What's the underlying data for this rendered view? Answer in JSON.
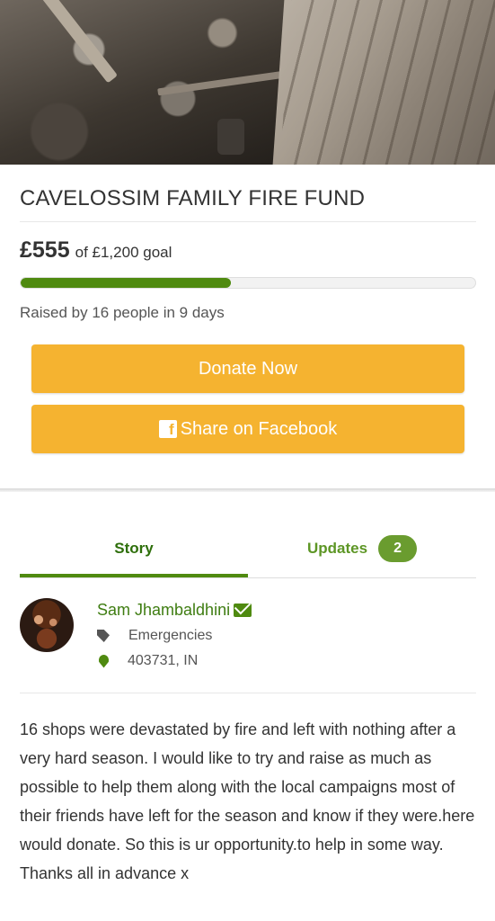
{
  "campaign": {
    "title": "CAVELOSSIM FAMILY FIRE FUND",
    "amount_raised": "£555",
    "goal_text": "of £1,200 goal",
    "progress_fraction": 0.4625,
    "raised_by": "Raised by 16 people in 9 days"
  },
  "buttons": {
    "donate_label": "Donate Now",
    "share_label": "Share on Facebook",
    "facebook_glyph": "f"
  },
  "tabs": [
    {
      "label": "Story",
      "active": true
    },
    {
      "label": "Updates",
      "active": false,
      "badge": "2"
    }
  ],
  "organizer": {
    "name": "Sam Jhambaldhini",
    "category": "Emergencies",
    "location": "403731, IN"
  },
  "story": {
    "text": "16 shops were devastated by fire and left with nothing after a very hard season. I would like to try and raise as much as possible to help them along with the local campaigns most of their friends have left for the season and know if they were.here would donate. So this is ur opportunity.to help in some way. Thanks all in advance x"
  },
  "colors": {
    "accent_green": "#4f8a10",
    "button_orange": "#f5b330",
    "badge_green": "#6a9c2f"
  },
  "icons": {
    "share_button": "facebook-icon",
    "organizer_name": "envelope-icon",
    "category": "tag-icon",
    "location": "map-pin-icon"
  }
}
